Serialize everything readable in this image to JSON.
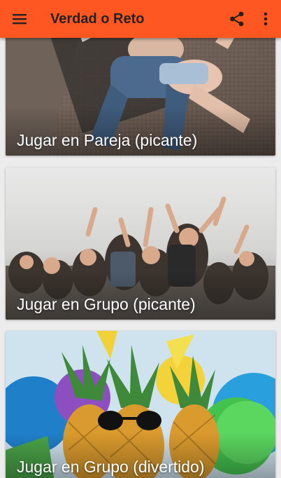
{
  "app_bar": {
    "title": "Verdad o Reto",
    "background": "#ff5722",
    "menu_icon": "hamburger-menu-icon",
    "share_icon": "share-icon",
    "more_icon": "more-vert-icon"
  },
  "cards": [
    {
      "label": "Jugar en Pareja (picante)"
    },
    {
      "label": "Jugar en Grupo (picante)"
    },
    {
      "label": "Jugar en Grupo (divertido)"
    }
  ]
}
